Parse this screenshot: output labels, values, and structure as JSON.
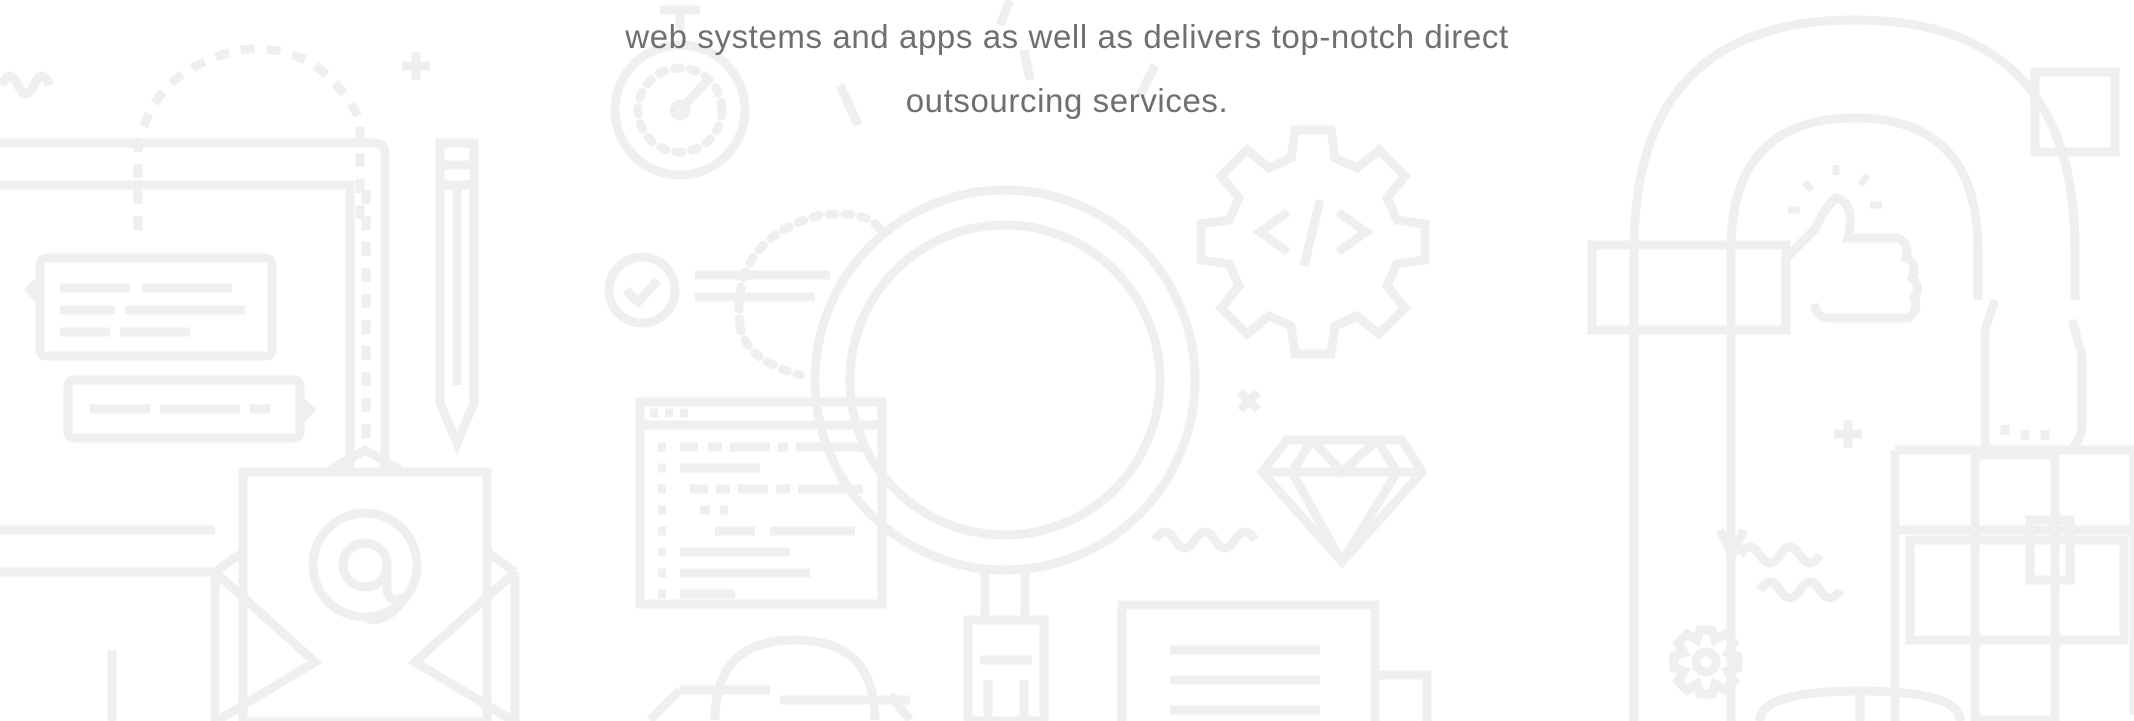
{
  "intro": {
    "line1": "web systems and apps as well as delivers top-notch direct",
    "line2": "outsourcing services."
  },
  "theme": {
    "background": "#ffffff",
    "text_color": "#6f6f6f",
    "illustration_stroke": "#efefef"
  },
  "illustrations": [
    "browser-window-icon",
    "message-bubble-icon",
    "pencil-icon",
    "email-envelope-at-icon",
    "stopwatch-icon",
    "checkmark-circle-icon",
    "magnifier-icon",
    "code-window-icon",
    "code-gear-icon",
    "diamond-icon",
    "usb-plug-icon",
    "globe-icon",
    "document-icon",
    "pipe-icon",
    "thumbs-up-icon",
    "hand-icon",
    "gift-box-icon",
    "small-gear-icon"
  ]
}
